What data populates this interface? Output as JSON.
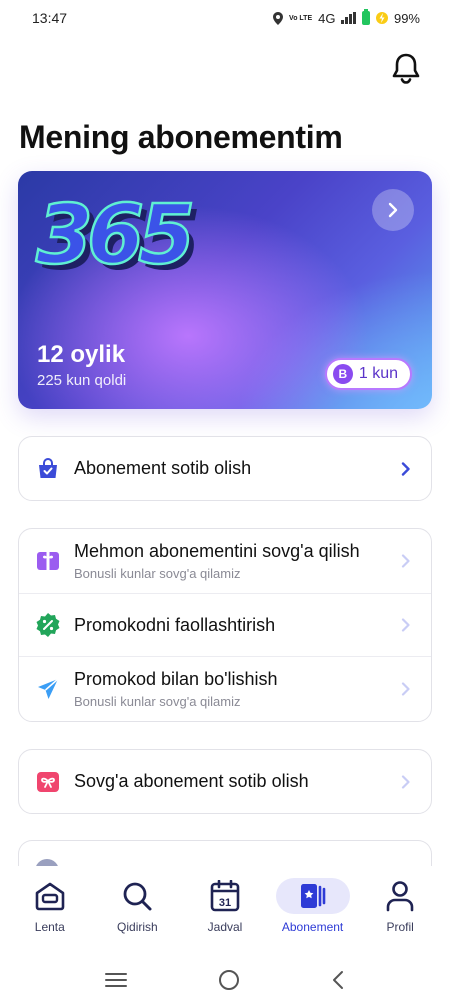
{
  "status_bar": {
    "time": "13:47",
    "network": "4G",
    "volte": "Vo LTE",
    "battery": "99%"
  },
  "page": {
    "title": "Mening abonementim"
  },
  "subscription": {
    "logo": "365",
    "plan": "12 oylik",
    "remaining": "225 kun qoldi",
    "bonus_letter": "B",
    "bonus_days": "1 kun"
  },
  "menu_groups": [
    {
      "items": [
        {
          "title": "Abonement sotib olish",
          "subtitle": "",
          "icon": "shopping-bag-icon",
          "color": "#3b4bd8",
          "chevron_color": "#3b4bd8"
        }
      ]
    },
    {
      "items": [
        {
          "title": "Mehmon abonementini sovg'a qilish",
          "subtitle": "Bonusli kunlar sovg'a qilamiz",
          "icon": "gift-icon",
          "color": "#9b5cf0",
          "chevron_color": "#c9cdf5"
        },
        {
          "title": "Promokodni faollashtirish",
          "subtitle": "",
          "icon": "percent-badge-icon",
          "color": "#22a55a",
          "chevron_color": "#c9cdf5"
        },
        {
          "title": "Promokod bilan bo'lishish",
          "subtitle": "Bonusli kunlar sovg'a qilamiz",
          "icon": "paper-plane-icon",
          "color": "#3b9ef5",
          "chevron_color": "#c9cdf5"
        }
      ]
    },
    {
      "items": [
        {
          "title": "Sovg'a abonement sotib olish",
          "subtitle": "",
          "icon": "gift-box-icon",
          "color": "#f0456e",
          "chevron_color": "#c9cdf5"
        }
      ]
    }
  ],
  "bottom_nav": [
    {
      "label": "Lenta",
      "icon": "home-icon",
      "active": false
    },
    {
      "label": "Qidirish",
      "icon": "search-icon",
      "active": false
    },
    {
      "label": "Jadval",
      "icon": "calendar-icon",
      "active": false,
      "badge": "31"
    },
    {
      "label": "Abonement",
      "icon": "subscription-card-icon",
      "active": true
    },
    {
      "label": "Profil",
      "icon": "profile-icon",
      "active": false
    }
  ],
  "colors": {
    "accent": "#2e3bd6",
    "active_nav_bg": "#e7e7fb"
  }
}
